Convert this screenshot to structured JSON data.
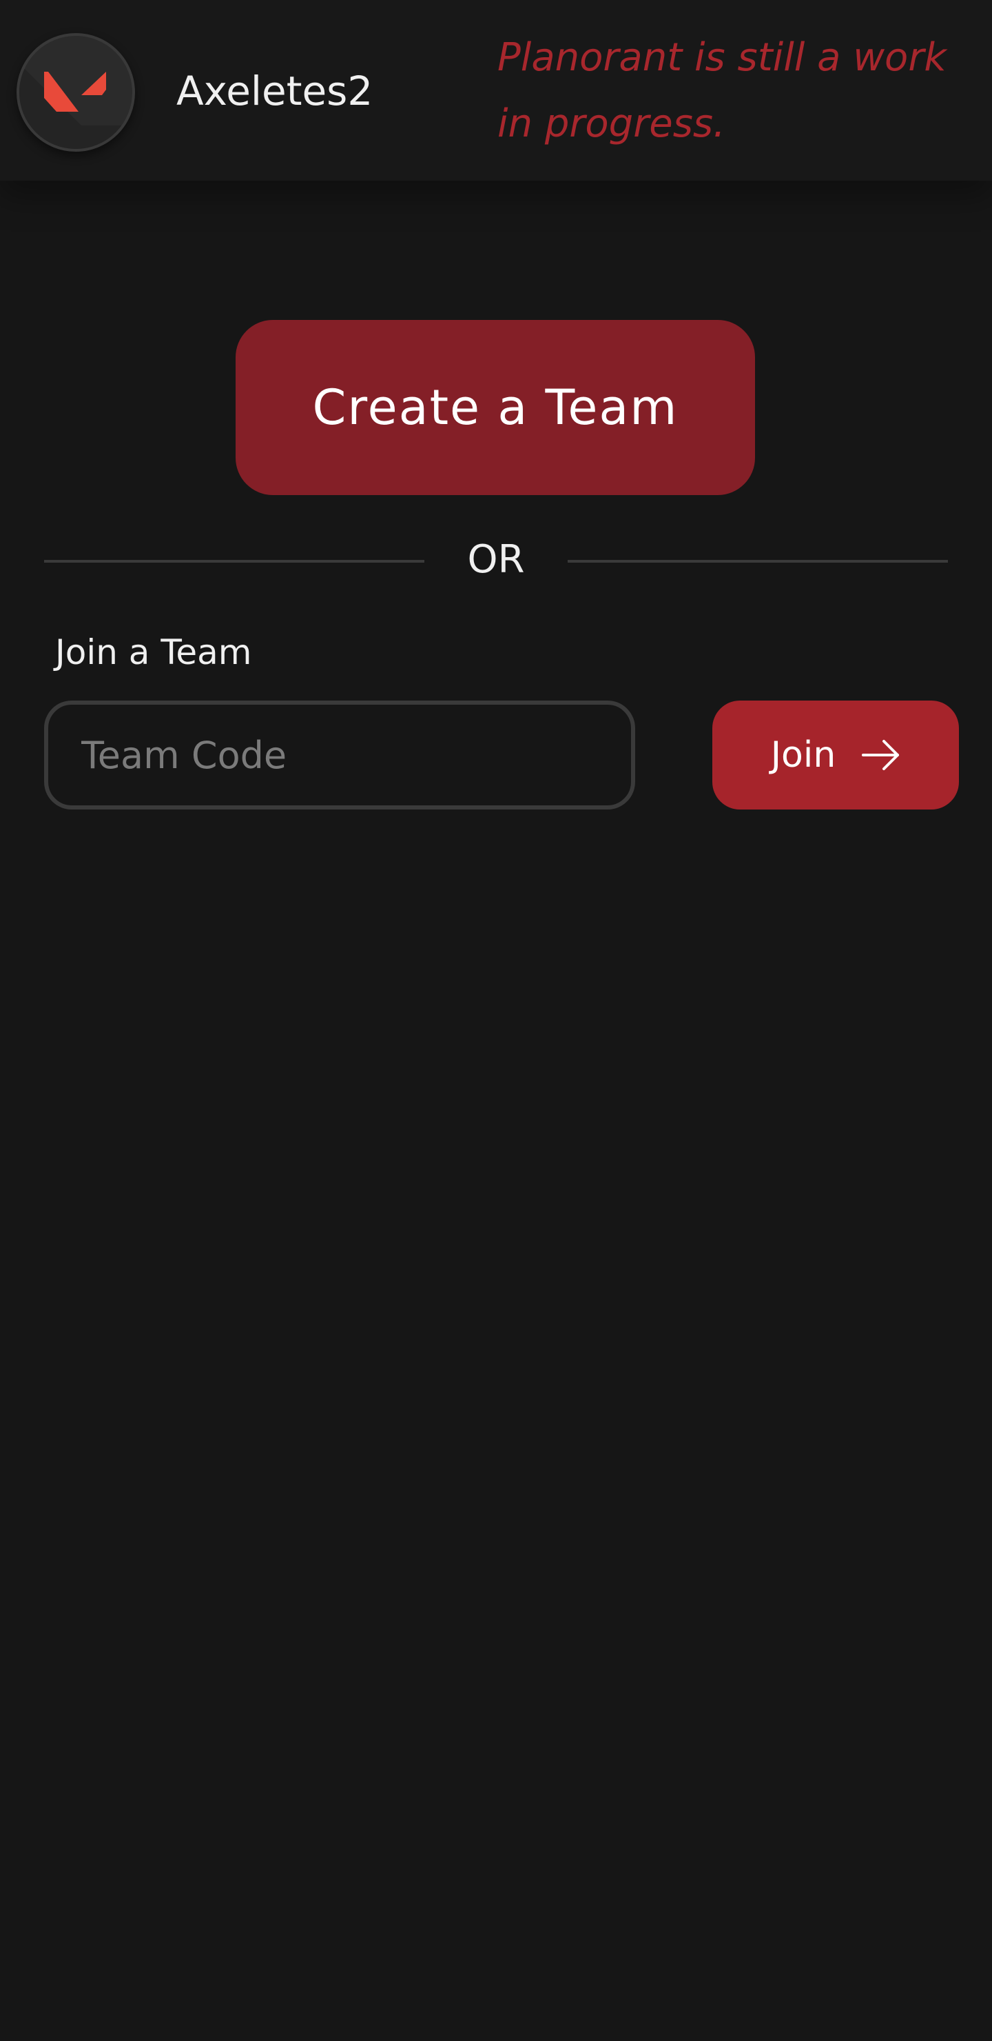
{
  "header": {
    "username": "Axeletes2",
    "notice": "Planorant is still a work in progress.",
    "avatar_icon": "valorant-logo-icon"
  },
  "main": {
    "create_team_label": "Create a Team",
    "divider_text": "OR",
    "join_team_label": "Join a Team",
    "team_code_placeholder": "Team Code",
    "team_code_value": "",
    "join_button_label": "Join",
    "join_button_icon": "arrow-right-icon"
  },
  "colors": {
    "background": "#161616",
    "accent": "#a6242b",
    "accent_dark": "#841f27",
    "notice_text": "#a8272d",
    "logo_red": "#e84a3a"
  }
}
